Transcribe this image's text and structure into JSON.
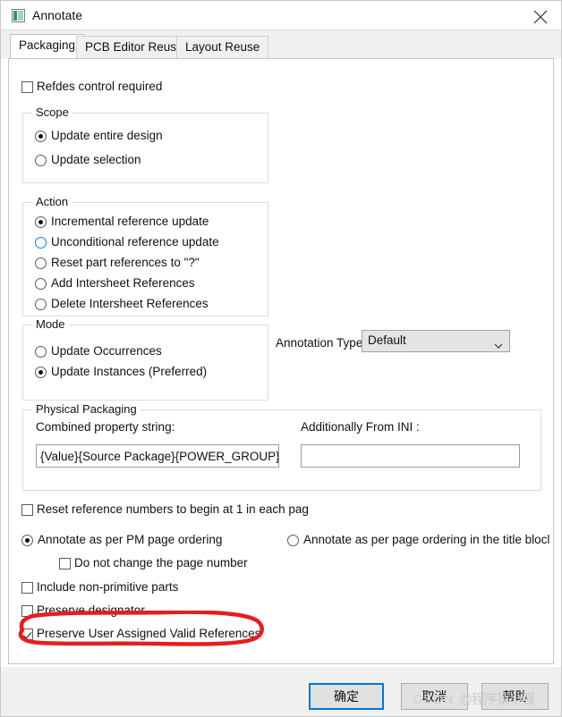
{
  "window": {
    "title": "Annotate",
    "icon": "app-window-icon",
    "close_label": "✕"
  },
  "tabs": [
    {
      "label": "Packaging",
      "active": true
    },
    {
      "label": "PCB Editor Reuse",
      "active": false
    },
    {
      "label": "Layout Reuse",
      "active": false
    }
  ],
  "packaging": {
    "refdes_control": {
      "label": "Refdes control required",
      "checked": false
    },
    "scope": {
      "title": "Scope",
      "options": [
        {
          "label": "Update entire design",
          "checked": true,
          "hover": false
        },
        {
          "label": "Update selection",
          "checked": false,
          "hover": false
        }
      ]
    },
    "action": {
      "title": "Action",
      "options": [
        {
          "label": "Incremental reference update",
          "checked": true,
          "hover": false
        },
        {
          "label": "Unconditional reference update",
          "checked": false,
          "hover": true
        },
        {
          "label": "Reset part references to \"?\"",
          "checked": false,
          "hover": false
        },
        {
          "label": "Add Intersheet References",
          "checked": false,
          "hover": false
        },
        {
          "label": "Delete Intersheet References",
          "checked": false,
          "hover": false
        }
      ]
    },
    "mode": {
      "title": "Mode",
      "options": [
        {
          "label": "Update Occurrences",
          "checked": false,
          "hover": false
        },
        {
          "label": "Update Instances (Preferred)",
          "checked": true,
          "hover": false
        }
      ]
    },
    "annotation_type": {
      "label": "Annotation Type",
      "value": "Default",
      "options": [
        "Default"
      ]
    },
    "physical_packaging": {
      "title": "Physical Packaging",
      "combined_property_label": "Combined property string:",
      "combined_property_value": "{Value}{Source Package}{POWER_GROUP}",
      "additionally_from_ini_label": "Additionally From INI :",
      "additionally_from_ini_value": ""
    },
    "reset_reference_numbers": {
      "label": "Reset reference numbers to begin at 1 in each pag",
      "checked": false
    },
    "ordering": {
      "pm_page_ordering": {
        "label": "Annotate as per PM page ordering",
        "checked": true
      },
      "title_block_ordering": {
        "label": "Annotate as per page ordering in the title blocl",
        "checked": false
      },
      "do_not_change_page_number": {
        "label": "Do not change the page number",
        "checked": false
      }
    },
    "include_non_primitive": {
      "label": "Include non-primitive parts",
      "checked": false
    },
    "preserve_designator": {
      "label": "Preserve designator",
      "checked": false
    },
    "preserve_user_assigned": {
      "label": "Preserve User Assigned Valid References",
      "checked": true
    }
  },
  "buttons": {
    "ok": "确定",
    "cancel": "取消",
    "help": "帮助"
  },
  "watermark": {
    "prefix": "CSDN ",
    "suffix": "@程序猿小强"
  },
  "colors": {
    "accent": "#0078d7",
    "hover_ring": "#0a84d8",
    "ink": "#e81c1c",
    "titlebar_bg": "#ffffff",
    "tabstrip_bg": "#f0f0f0",
    "panel_bg": "#ffffff",
    "groupbox_border": "#dcdcdc"
  }
}
